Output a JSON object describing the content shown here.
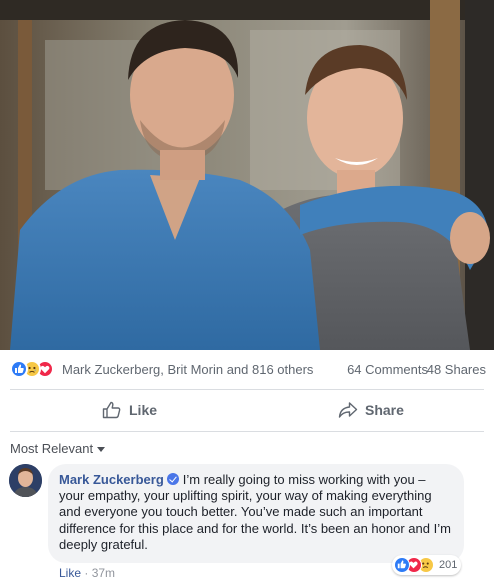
{
  "post": {
    "photo_icon": "photo-of-two-people"
  },
  "reactions": {
    "icons": [
      "like-icon",
      "sad-icon",
      "love-icon"
    ],
    "summary": "Mark Zuckerberg, Brit Morin and 816 others",
    "comments": "64 Comments",
    "shares": "48 Shares"
  },
  "actions": {
    "like": "Like",
    "share": "Share"
  },
  "comments": {
    "sort_label": "Most Relevant",
    "items": [
      {
        "author": "Mark Zuckerberg",
        "text": "I’m really going to miss working with you – your empathy, your uplifting spirit, your way of making everything and everyone you touch better. You’ve made such an important difference for this place and for the world. It’s been an honor and I’m deeply grateful.",
        "reaction_count": "201",
        "like_label": "Like",
        "separator": "·",
        "time": "37m"
      }
    ]
  },
  "colors": {
    "link": "#385898",
    "like_blue": "#2e7bf6",
    "love_red": "#f0284a",
    "sad_yellow": "#f7c846",
    "bubble_bg": "#f2f3f5"
  }
}
